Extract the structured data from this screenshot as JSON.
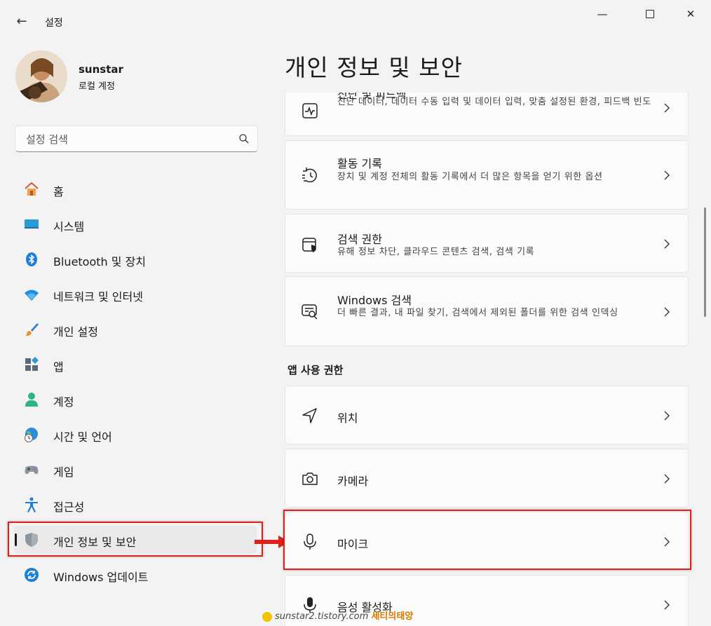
{
  "titlebar": {
    "back": "←",
    "title": "설정",
    "minimize": "—",
    "close": "✕"
  },
  "profile": {
    "name": "sunstar",
    "account": "로컬 계정"
  },
  "search": {
    "placeholder": "설정 검색"
  },
  "sidebar": {
    "items": [
      {
        "label": "홈",
        "icon": "home-icon"
      },
      {
        "label": "시스템",
        "icon": "system-icon"
      },
      {
        "label": "Bluetooth 및 장치",
        "icon": "bluetooth-icon"
      },
      {
        "label": "네트워크 및 인터넷",
        "icon": "wifi-icon"
      },
      {
        "label": "개인 설정",
        "icon": "brush-icon"
      },
      {
        "label": "앱",
        "icon": "apps-icon"
      },
      {
        "label": "계정",
        "icon": "account-icon"
      },
      {
        "label": "시간 및 언어",
        "icon": "globe-clock-icon"
      },
      {
        "label": "게임",
        "icon": "gamepad-icon"
      },
      {
        "label": "접근성",
        "icon": "accessibility-icon"
      },
      {
        "label": "개인 정보 및 보안",
        "icon": "shield-icon",
        "selected": true
      },
      {
        "label": "Windows 업데이트",
        "icon": "update-icon"
      }
    ]
  },
  "main": {
    "title": "개인 정보 및 보안",
    "cards": [
      {
        "title": "진단 및 피드백",
        "desc": "진단 데이터, 데이터 수동 입력 및 데이터 입력, 맞춤 설정된 환경, 피드백 빈도",
        "icon": "diagnostics-icon"
      },
      {
        "title": "활동 기록",
        "desc": "장치 및 계정 전체의 활동 기록에서 더 많은 항목을 얻기 위한 옵션",
        "icon": "history-icon"
      },
      {
        "title": "검색 권한",
        "desc": "유해 정보 차단, 클라우드 콘텐츠 검색, 검색 기록",
        "icon": "search-shield-icon"
      },
      {
        "title": "Windows 검색",
        "desc": "더 빠른 결과, 내 파일 찾기, 검색에서 제외된 폴더를 위한 검색 인덱싱",
        "icon": "windows-search-icon"
      }
    ],
    "app_permissions_heading": "앱 사용 권한",
    "permissions": [
      {
        "title": "위치",
        "icon": "location-icon"
      },
      {
        "title": "카메라",
        "icon": "camera-icon"
      },
      {
        "title": "마이크",
        "icon": "microphone-icon",
        "highlighted": true
      },
      {
        "title": "음성 활성화",
        "icon": "voice-icon"
      }
    ]
  },
  "watermark": {
    "site": "sunstar2.tistory.com",
    "brand": "세티의태양"
  },
  "colors": {
    "background": "#f3f3f3",
    "card": "#fbfbfb",
    "highlight_box": "#e0201a",
    "accent": "#0067c0"
  }
}
